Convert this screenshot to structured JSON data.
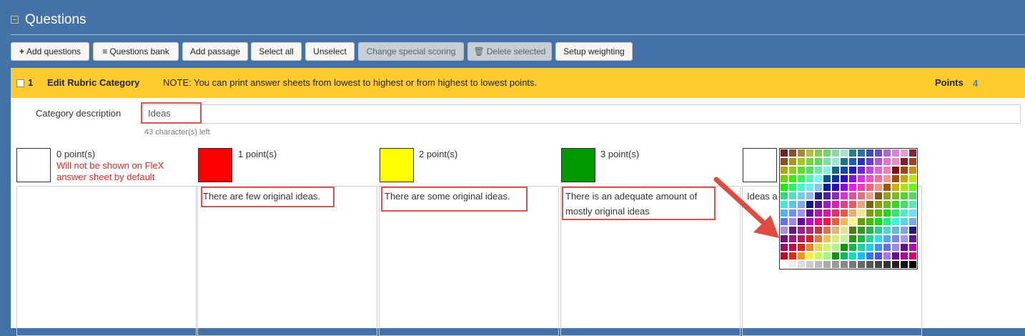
{
  "header": {
    "title": "Questions"
  },
  "toolbar": {
    "buttons": [
      {
        "label": "Add questions",
        "icon": "plus-icon",
        "disabled": false
      },
      {
        "label": "Questions bank",
        "icon": "list-icon",
        "disabled": false
      },
      {
        "label": "Add passage",
        "disabled": false
      },
      {
        "label": "Select all",
        "disabled": false
      },
      {
        "label": "Unselect",
        "disabled": false
      },
      {
        "label": "Change special scoring",
        "disabled": true
      },
      {
        "label": "Delete selected",
        "icon": "trash-icon",
        "disabled": true
      },
      {
        "label": "Setup weighting",
        "disabled": false
      }
    ]
  },
  "rubric": {
    "number": "1",
    "title": "Edit Rubric Category",
    "note": "NOTE: You can print answer sheets from lowest to highest or from highest to lowest points.",
    "points_label": "Points",
    "points_value": "4",
    "description_label": "Category description",
    "description_value": "Ideas",
    "chars_left": "43 character(s) left",
    "warning": "Will not be shown on FleX answer sheet by default",
    "levels": [
      {
        "points": "0 point(s)",
        "color": "#ffffff",
        "text": ""
      },
      {
        "points": "1 point(s)",
        "color": "#ff0000",
        "text": "There are few original ideas."
      },
      {
        "points": "2 point(s)",
        "color": "#ffff00",
        "text": "There are some original ideas."
      },
      {
        "points": "3 point(s)",
        "color": "#009900",
        "text": "There is an adequate amount of mostly original ideas"
      },
      {
        "points": "",
        "color": "#ffffff",
        "text": "Ideas a"
      }
    ]
  },
  "colors": {
    "header_bg": "#4472a8",
    "bar_bg": "#fecb2e",
    "highlight": "#d9534f",
    "arrow": "#e04b3f"
  }
}
